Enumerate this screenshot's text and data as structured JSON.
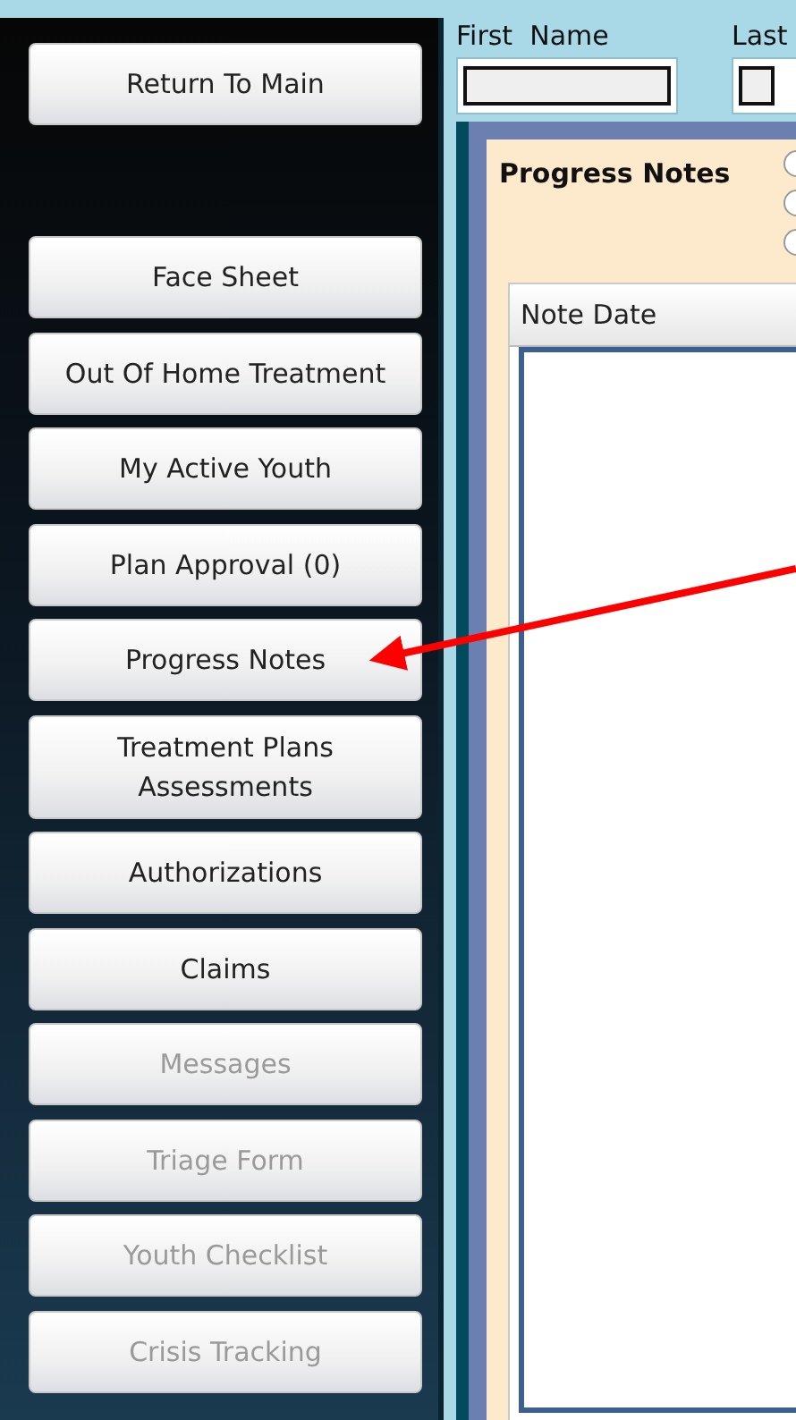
{
  "sidebar": {
    "return_button": "Return To Main",
    "items": [
      {
        "label": "Face Sheet",
        "disabled": false
      },
      {
        "label": "Out Of Home Treatment",
        "disabled": false
      },
      {
        "label": "My Active Youth",
        "disabled": false
      },
      {
        "label": "Plan Approval (0)",
        "disabled": false
      },
      {
        "label": "Progress Notes",
        "disabled": false
      },
      {
        "label": "Treatment Plans Assessments",
        "disabled": false
      },
      {
        "label": "Authorizations",
        "disabled": false
      },
      {
        "label": "Claims",
        "disabled": false
      },
      {
        "label": "Messages",
        "disabled": true
      },
      {
        "label": "Triage Form",
        "disabled": true
      },
      {
        "label": "Youth Checklist",
        "disabled": true
      },
      {
        "label": "Crisis Tracking",
        "disabled": true
      }
    ]
  },
  "header": {
    "first_name_label": "First  Name",
    "last_name_label": "Last"
  },
  "panel": {
    "title": "Progress Notes",
    "radios": [
      {
        "selected": false
      },
      {
        "selected": false
      },
      {
        "selected": false
      }
    ],
    "grid": {
      "columns": [
        "Note Date"
      ]
    }
  }
}
